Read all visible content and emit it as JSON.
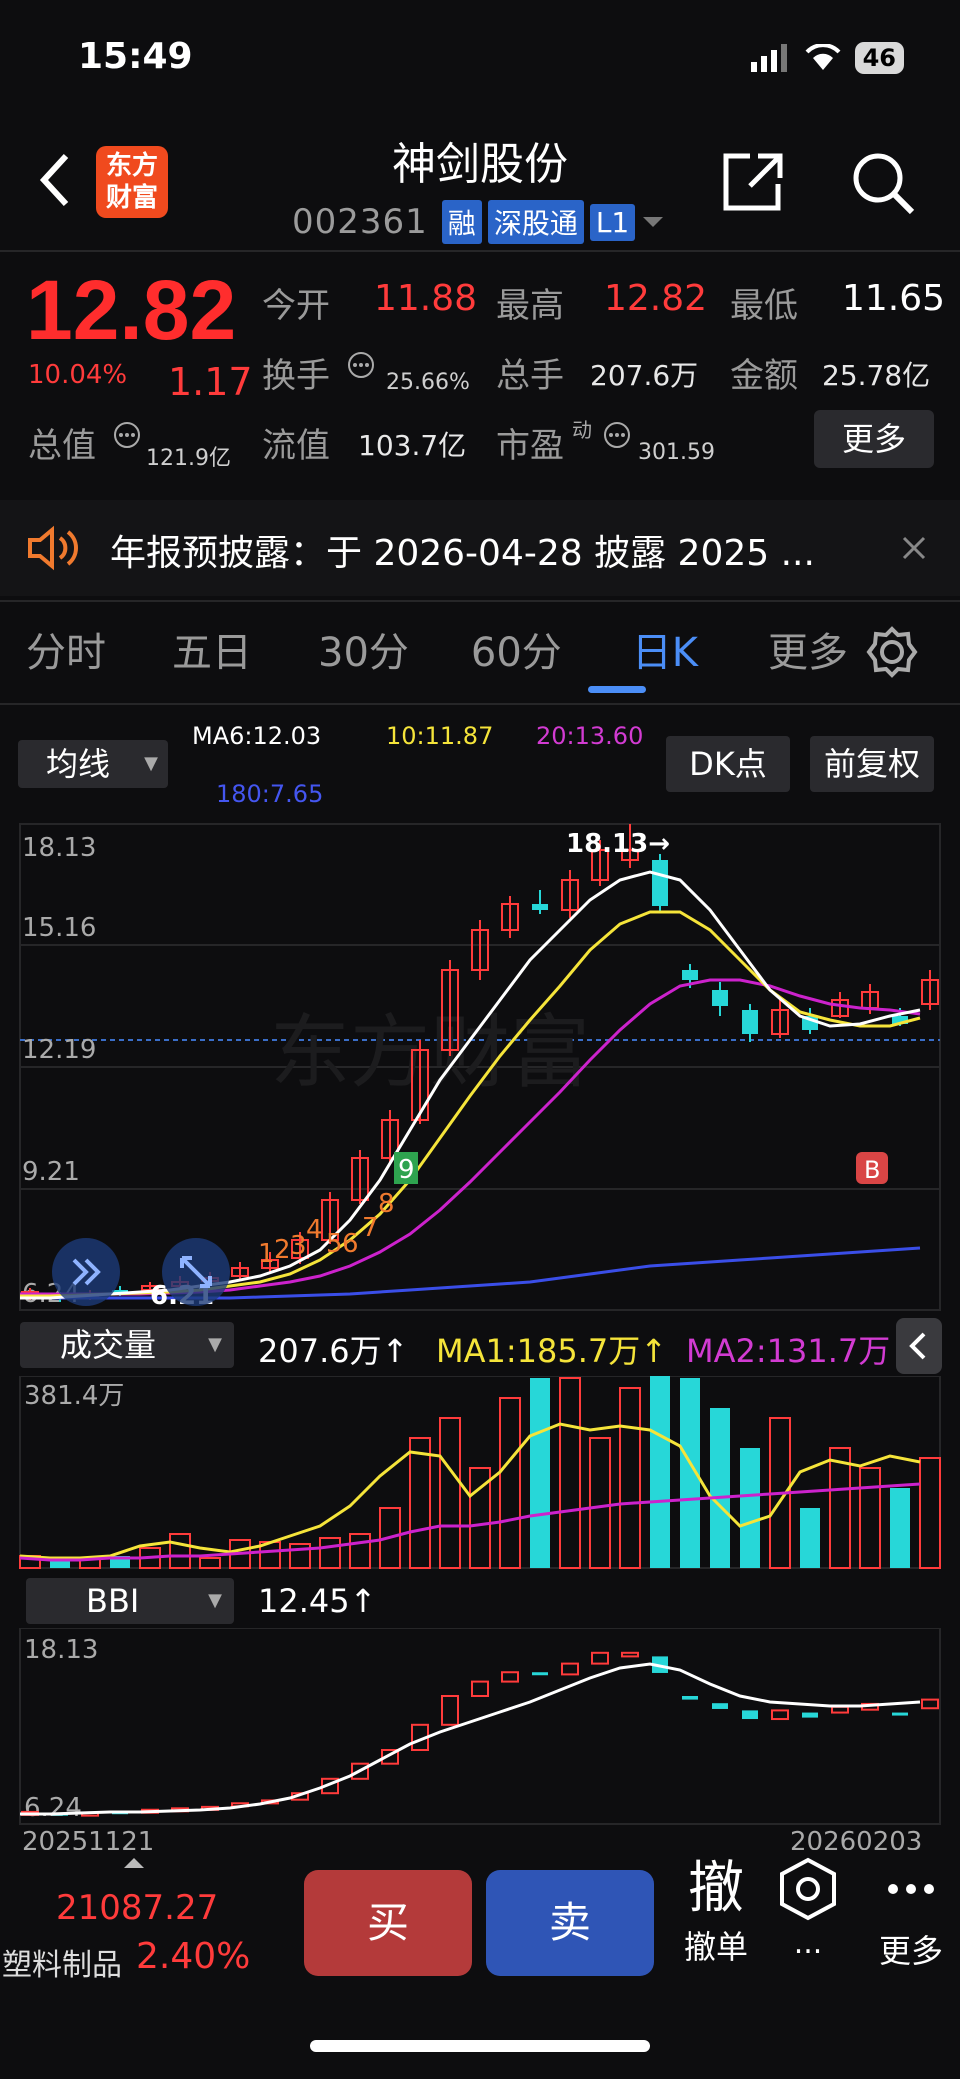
{
  "status": {
    "time": "15:49",
    "battery": "46"
  },
  "header": {
    "title": "神剑股份",
    "code": "002361",
    "tags": [
      "融",
      "深股通",
      "L1"
    ]
  },
  "quote": {
    "price": "12.82",
    "change_pct": "10.04%",
    "change": "1.17",
    "open_label": "今开",
    "open": "11.88",
    "high_label": "最高",
    "high": "12.82",
    "low_label": "最低",
    "low": "11.65",
    "turnover_label": "换手",
    "turnover": "25.66%",
    "volume_label": "总手",
    "volume": "207.6万",
    "amount_label": "金额",
    "amount": "25.78亿",
    "mktcap_label": "总值",
    "mktcap": "121.9亿",
    "float_label": "流值",
    "float": "103.7亿",
    "pe_label": "市盈",
    "pe_sup": "动",
    "pe": "301.59",
    "more": "更多"
  },
  "notice": {
    "text": "年报预披露：于 2026-04-28 披露 2025 ..."
  },
  "tabs": [
    "分时",
    "五日",
    "30分",
    "60分",
    "日K",
    "更多"
  ],
  "active_tab": "日K",
  "ma_bar": {
    "select": "均线",
    "ma6": "MA6:12.03",
    "ma10": "10:11.87",
    "ma20": "20:13.60",
    "ma180": "180:7.65",
    "dk": "DK点",
    "fq": "前复权"
  },
  "kline": {
    "y_labels": [
      "18.13",
      "15.16",
      "12.19",
      "9.21",
      "6.24"
    ],
    "high_marker": "18.13→",
    "low_marker": "6.21",
    "b_marker": "B",
    "nine_counts": [
      "1",
      "2",
      "3",
      "4",
      "5",
      "6",
      "7",
      "8",
      "9"
    ],
    "watermark": "东方财富"
  },
  "volume": {
    "select": "成交量",
    "current": "207.6万",
    "ma1": "MA1:185.7万",
    "ma2": "MA2:131.7万",
    "max_label": "381.4万"
  },
  "bbi": {
    "select": "BBI",
    "value": "12.45",
    "y_labels": [
      "18.13",
      "6.24"
    ],
    "date_start": "20251121",
    "date_end": "20260203"
  },
  "bottom": {
    "index_value": "21087.27",
    "sector": "塑料制品",
    "sector_pct": "2.40%",
    "buy": "买",
    "sell": "卖",
    "cancel_icon_char": "撤",
    "cancel": "撤单",
    "more_dots": "...",
    "more": "更多"
  },
  "colors": {
    "up": "#ff3b3b",
    "down": "#27d7d8",
    "ma6": "#ffffff",
    "ma10": "#f5e43a",
    "ma20": "#cc22cc",
    "ma180": "#3a4ee8"
  },
  "chart_data": {
    "type": "candlestick",
    "ma_lines": [
      "MA6",
      "MA10",
      "MA20",
      "MA180"
    ],
    "ylim": [
      6.24,
      18.13
    ],
    "last_close": 12.82
  }
}
